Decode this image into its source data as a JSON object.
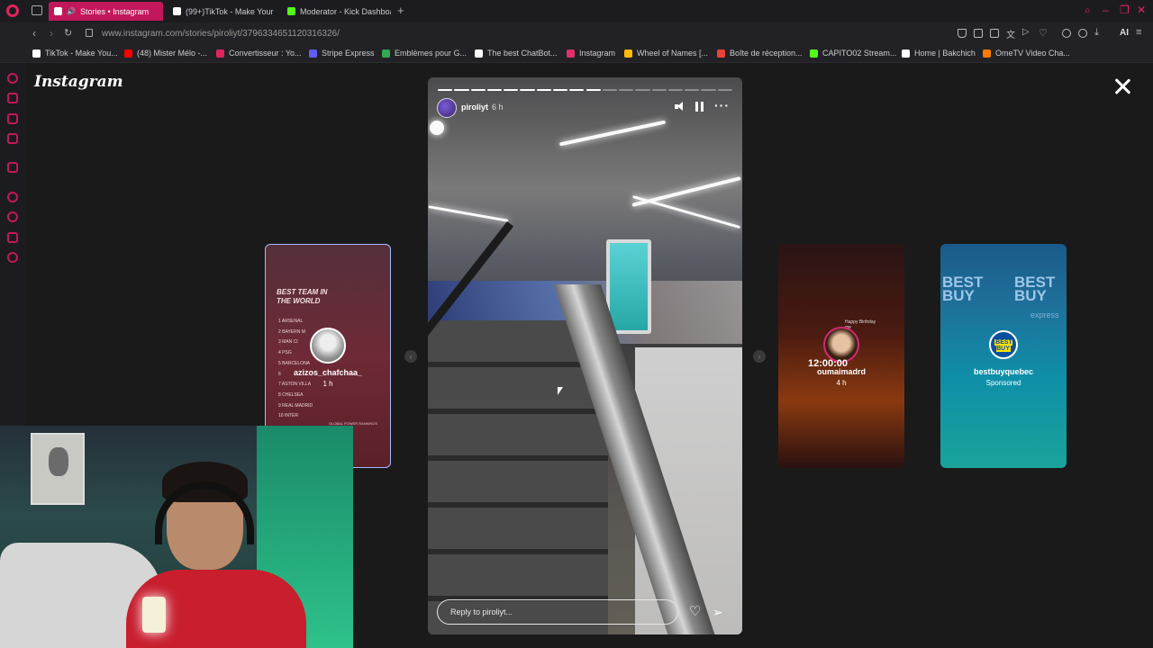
{
  "browser": {
    "tabs": [
      {
        "label": "Stories • Instagram",
        "active": true,
        "favicon_color": "#e1306c"
      },
      {
        "label": "(99+)TikTok - Make Your",
        "active": false,
        "favicon_color": "#ffffff"
      },
      {
        "label": "Moderator - Kick Dashboa",
        "active": false,
        "favicon_color": "#53fc18"
      }
    ],
    "url": "www.instagram.com/stories/piroliyt/3796334651120316326/",
    "ai_label": "AI",
    "bookmarks": [
      {
        "label": "TikTok - Make You...",
        "color": "#ffffff"
      },
      {
        "label": "(48) Mister Mélo -...",
        "color": "#ff0000"
      },
      {
        "label": "Convertisseur : Yo...",
        "color": "#e0245e"
      },
      {
        "label": "Stripe Express",
        "color": "#635bff"
      },
      {
        "label": "Emblèmes pour G...",
        "color": "#34a853"
      },
      {
        "label": "The best ChatBot...",
        "color": "#ffffff"
      },
      {
        "label": "Instagram",
        "color": "#e1306c"
      },
      {
        "label": "Wheel of Names [...",
        "color": "#fbbc05"
      },
      {
        "label": "Boîte de réception...",
        "color": "#ea4335"
      },
      {
        "label": "CAPITO02 Stream...",
        "color": "#53fc18"
      },
      {
        "label": "Home | Bakchich",
        "color": "#ffffff"
      },
      {
        "label": "OmeTV Video Cha...",
        "color": "#ff7a00"
      }
    ]
  },
  "instagram": {
    "logo": "Instagram",
    "story": {
      "username": "piroliyt",
      "time": "6 h",
      "reply_placeholder": "Reply to piroliyt...",
      "progress_segments_total": 18,
      "progress_segments_done": 10
    },
    "previews": [
      {
        "username": "azizos_chafchaa_",
        "meta": "1 h",
        "title": "BEST TEAM IN THE WORLD",
        "ranks": [
          "1 ARSENAL",
          "2 BAYERN M",
          "3 MAN CI",
          "4 PSG",
          "5 BARCELONA",
          "6",
          "7 ASTON VILLA",
          "8 CHELSEA",
          "9 REAL MADRID",
          "10 INTER"
        ],
        "footer": "GLOBAL POWER RANKINGS"
      },
      {
        "username": "oumaimadrd",
        "meta": "4 h",
        "clock": "12:00:00",
        "caption": "Happy Birthday me"
      },
      {
        "username": "bestbuyquebec",
        "meta": "Sponsored",
        "brand_word": "BEST BUY",
        "brand_express": "express",
        "avatar_text": "BEST BUY"
      }
    ]
  }
}
